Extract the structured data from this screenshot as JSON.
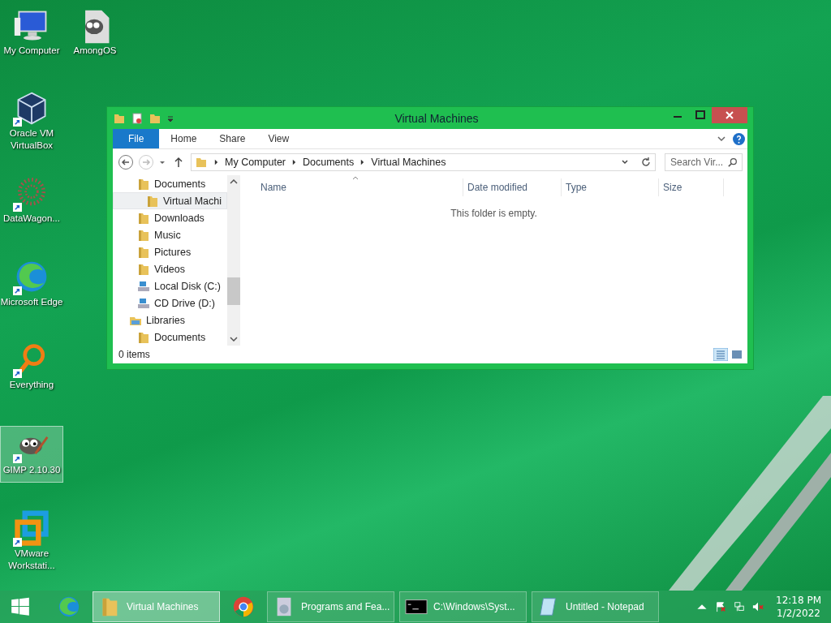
{
  "desktop_icons": [
    {
      "label": "My Computer",
      "shortcut": false,
      "selected": false
    },
    {
      "label": "AmongOS",
      "shortcut": false,
      "selected": false
    },
    {
      "label": "Oracle VM VirtualBox",
      "shortcut": true,
      "selected": false
    },
    {
      "label": "DataWagon...",
      "shortcut": true,
      "selected": false
    },
    {
      "label": "Microsoft Edge",
      "shortcut": true,
      "selected": false
    },
    {
      "label": "Everything",
      "shortcut": true,
      "selected": false
    },
    {
      "label": "GIMP 2.10.30",
      "shortcut": true,
      "selected": true
    },
    {
      "label": "VMware Workstati...",
      "shortcut": true,
      "selected": false
    }
  ],
  "window": {
    "title": "Virtual Machines",
    "ribbon_tabs": [
      {
        "label": "File",
        "selected": true
      },
      {
        "label": "Home",
        "selected": false
      },
      {
        "label": "Share",
        "selected": false
      },
      {
        "label": "View",
        "selected": false
      }
    ],
    "breadcrumb": [
      "My Computer",
      "Documents",
      "Virtual Machines"
    ],
    "search": {
      "placeholder": "Search Vir..."
    },
    "nav_tree": [
      {
        "children": [
          {
            "label": "Documents",
            "kind": "folder",
            "selected": false,
            "children": [
              {
                "label": "Virtual Machi",
                "kind": "folder",
                "selected": true
              }
            ]
          },
          {
            "label": "Downloads",
            "kind": "folder",
            "selected": false
          },
          {
            "label": "Music",
            "kind": "folder",
            "selected": false
          },
          {
            "label": "Pictures",
            "kind": "folder",
            "selected": false
          },
          {
            "label": "Videos",
            "kind": "folder",
            "selected": false
          },
          {
            "label": "Local Disk (C:)",
            "kind": "drive",
            "selected": false
          },
          {
            "label": "CD Drive (D:)",
            "kind": "drive",
            "selected": false
          }
        ]
      },
      {
        "label": "Libraries",
        "kind": "library",
        "selected": false,
        "children": [
          {
            "label": "Documents",
            "kind": "folder",
            "selected": false
          }
        ]
      }
    ],
    "columns": [
      "Name",
      "Date modified",
      "Type",
      "Size"
    ],
    "empty_message": "This folder is empty.",
    "status": "0 items",
    "views": [
      {
        "kind": "details",
        "selected": true
      },
      {
        "kind": "large",
        "selected": false
      }
    ]
  },
  "taskbar": {
    "items": [
      {
        "kind": "pinned"
      },
      {
        "kind": "window",
        "label": "Virtual Machines",
        "selected": true
      },
      {
        "kind": "pinned"
      },
      {
        "kind": "window",
        "label": "Programs and Fea...",
        "selected": false
      },
      {
        "kind": "window",
        "label": "C:\\Windows\\Syst...",
        "selected": false
      },
      {
        "kind": "window",
        "label": "Untitled - Notepad",
        "selected": false
      }
    ],
    "time": "12:18 PM",
    "date": "1/2/2022"
  }
}
